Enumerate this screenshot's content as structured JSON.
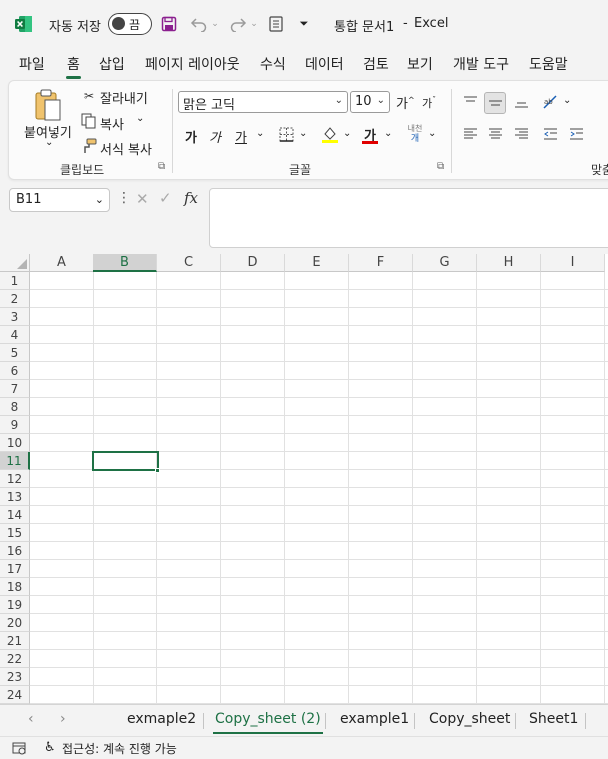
{
  "titlebar": {
    "autosave_label": "자동 저장",
    "autosave_state": "끔",
    "doc_title": "통합 문서1",
    "separator": "-",
    "app_name": "Excel"
  },
  "menu": [
    "파일",
    "홈",
    "삽입",
    "페이지 레이아웃",
    "수식",
    "데이터",
    "검토",
    "보기",
    "개발 도구",
    "도움말"
  ],
  "ribbon": {
    "clipboard": {
      "paste": "붙여넣기",
      "cut": "잘라내기",
      "copy": "복사",
      "format_painter": "서식 복사",
      "group_label": "클립보드"
    },
    "font": {
      "font_name": "맑은 고딕",
      "font_size": "10",
      "increase_size": "가",
      "decrease_size": "가",
      "bold": "가",
      "italic": "가",
      "underline": "가",
      "font_color_label": "가",
      "phonetic_top": "내천",
      "phonetic_bottom": "개",
      "group_label": "글꼴"
    },
    "alignment": {
      "group_label": "맞춤"
    }
  },
  "formula_bar": {
    "name_box": "B11",
    "fx": "fx",
    "content": ""
  },
  "grid": {
    "columns": [
      "A",
      "B",
      "C",
      "D",
      "E",
      "F",
      "G",
      "H",
      "I"
    ],
    "rows": [
      "1",
      "2",
      "3",
      "4",
      "5",
      "6",
      "7",
      "8",
      "9",
      "10",
      "11",
      "12",
      "13",
      "14",
      "15",
      "16",
      "17",
      "18",
      "19",
      "20",
      "21",
      "22",
      "23",
      "24"
    ],
    "selected_column": "B",
    "selected_row": "11"
  },
  "sheets": {
    "tabs": [
      "exmaple2",
      "Copy_sheet (2)",
      "example1",
      "Copy_sheet",
      "Sheet1"
    ],
    "active": "Copy_sheet (2)"
  },
  "status": {
    "accessibility": "접근성: 계속 진행 가능"
  },
  "colors": {
    "accent": "#1e7145",
    "highlight_yellow": "#ffff00",
    "font_red": "#e00000"
  }
}
